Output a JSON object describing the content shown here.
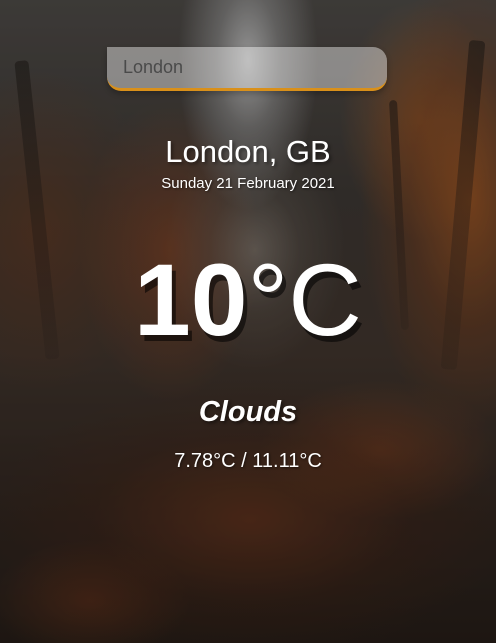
{
  "search": {
    "placeholder": "London"
  },
  "location": {
    "label": "London, GB"
  },
  "date": {
    "label": "Sunday 21 February 2021"
  },
  "temperature": {
    "value": "10",
    "unit": "°C"
  },
  "weather": {
    "description": "Clouds",
    "hi_lo": "7.78°C / 11.11°C"
  },
  "colors": {
    "accent": "#d9901a",
    "text": "#ffffff"
  }
}
